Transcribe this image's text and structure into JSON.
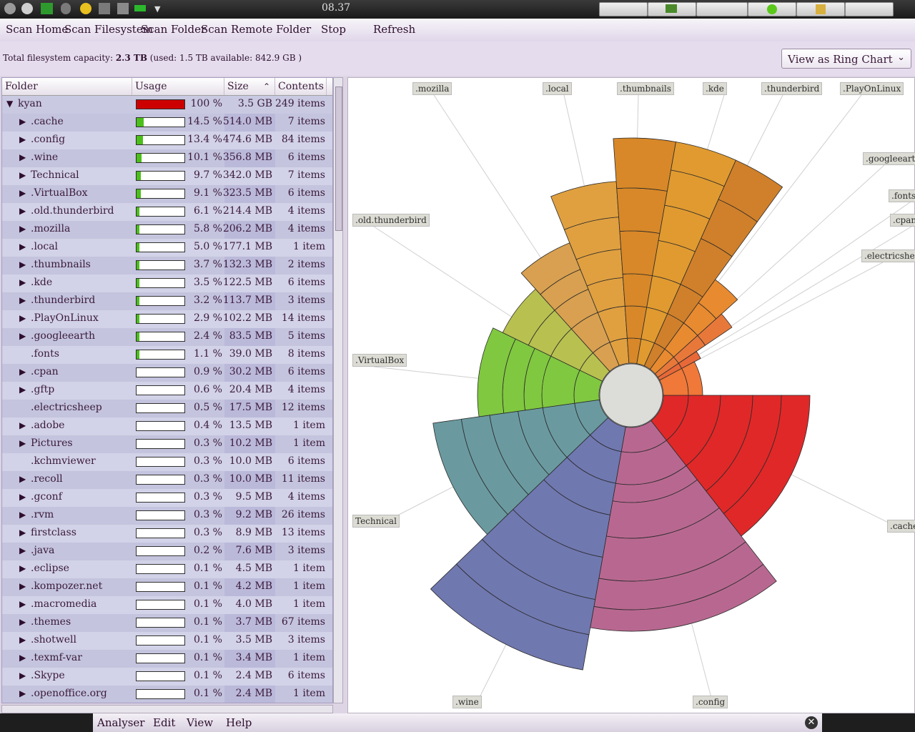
{
  "panel": {
    "clock": "08.37"
  },
  "toolbar": {
    "scan_home": "Scan Home",
    "scan_filesystem": "Scan Filesystem",
    "scan_folder": "Scan Folder",
    "scan_remote": "Scan Remote Folder",
    "stop": "Stop",
    "refresh": "Refresh"
  },
  "capacity": {
    "prefix": "Total filesystem capacity:",
    "total": "2.3 TB",
    "detail": "(used: 1.5 TB available: 842.9 GB )"
  },
  "view_select": {
    "value": "View as Ring Chart"
  },
  "list": {
    "headers": {
      "folder": "Folder",
      "usage": "Usage",
      "size": "Size",
      "contents": "Contents"
    },
    "rows": [
      {
        "name": "kyan",
        "pct": "100 %",
        "usage": 100,
        "size": "3.5 GB",
        "contents": "249 items",
        "expanded": true,
        "level": 0,
        "has_children": true
      },
      {
        "name": ".cache",
        "pct": "14.5 %",
        "usage": 14.5,
        "size": "514.0 MB",
        "contents": "7 items",
        "level": 1,
        "has_children": true
      },
      {
        "name": ".config",
        "pct": "13.4 %",
        "usage": 13.4,
        "size": "474.6 MB",
        "contents": "84 items",
        "level": 1,
        "has_children": true
      },
      {
        "name": ".wine",
        "pct": "10.1 %",
        "usage": 10.1,
        "size": "356.8 MB",
        "contents": "6 items",
        "level": 1,
        "has_children": true
      },
      {
        "name": "Technical",
        "pct": "9.7 %",
        "usage": 9.7,
        "size": "342.0 MB",
        "contents": "7 items",
        "level": 1,
        "has_children": true
      },
      {
        "name": ".VirtualBox",
        "pct": "9.1 %",
        "usage": 9.1,
        "size": "323.5 MB",
        "contents": "6 items",
        "level": 1,
        "has_children": true
      },
      {
        "name": ".old.thunderbird",
        "pct": "6.1 %",
        "usage": 6.1,
        "size": "214.4 MB",
        "contents": "4 items",
        "level": 1,
        "has_children": true
      },
      {
        "name": ".mozilla",
        "pct": "5.8 %",
        "usage": 5.8,
        "size": "206.2 MB",
        "contents": "4 items",
        "level": 1,
        "has_children": true
      },
      {
        "name": ".local",
        "pct": "5.0 %",
        "usage": 5.0,
        "size": "177.1 MB",
        "contents": "1 item",
        "level": 1,
        "has_children": true
      },
      {
        "name": ".thumbnails",
        "pct": "3.7 %",
        "usage": 3.7,
        "size": "132.3 MB",
        "contents": "2 items",
        "level": 1,
        "has_children": true
      },
      {
        "name": ".kde",
        "pct": "3.5 %",
        "usage": 3.5,
        "size": "122.5 MB",
        "contents": "6 items",
        "level": 1,
        "has_children": true
      },
      {
        "name": ".thunderbird",
        "pct": "3.2 %",
        "usage": 3.2,
        "size": "113.7 MB",
        "contents": "3 items",
        "level": 1,
        "has_children": true
      },
      {
        "name": ".PlayOnLinux",
        "pct": "2.9 %",
        "usage": 2.9,
        "size": "102.2 MB",
        "contents": "14 items",
        "level": 1,
        "has_children": true
      },
      {
        "name": ".googleearth",
        "pct": "2.4 %",
        "usage": 2.4,
        "size": "83.5 MB",
        "contents": "5 items",
        "level": 1,
        "has_children": true
      },
      {
        "name": ".fonts",
        "pct": "1.1 %",
        "usage": 1.1,
        "size": "39.0 MB",
        "contents": "8 items",
        "level": 1,
        "has_children": false
      },
      {
        "name": ".cpan",
        "pct": "0.9 %",
        "usage": 0.9,
        "size": "30.2 MB",
        "contents": "6 items",
        "level": 1,
        "has_children": true
      },
      {
        "name": ".gftp",
        "pct": "0.6 %",
        "usage": 0.6,
        "size": "20.4 MB",
        "contents": "4 items",
        "level": 1,
        "has_children": true
      },
      {
        "name": ".electricsheep",
        "pct": "0.5 %",
        "usage": 0.5,
        "size": "17.5 MB",
        "contents": "12 items",
        "level": 1,
        "has_children": false
      },
      {
        "name": ".adobe",
        "pct": "0.4 %",
        "usage": 0.4,
        "size": "13.5 MB",
        "contents": "1 item",
        "level": 1,
        "has_children": true
      },
      {
        "name": "Pictures",
        "pct": "0.3 %",
        "usage": 0.3,
        "size": "10.2 MB",
        "contents": "1 item",
        "level": 1,
        "has_children": true
      },
      {
        "name": ".kchmviewer",
        "pct": "0.3 %",
        "usage": 0.3,
        "size": "10.0 MB",
        "contents": "6 items",
        "level": 1,
        "has_children": false
      },
      {
        "name": ".recoll",
        "pct": "0.3 %",
        "usage": 0.3,
        "size": "10.0 MB",
        "contents": "11 items",
        "level": 1,
        "has_children": true
      },
      {
        "name": ".gconf",
        "pct": "0.3 %",
        "usage": 0.3,
        "size": "9.5 MB",
        "contents": "4 items",
        "level": 1,
        "has_children": true
      },
      {
        "name": ".rvm",
        "pct": "0.3 %",
        "usage": 0.3,
        "size": "9.2 MB",
        "contents": "26 items",
        "level": 1,
        "has_children": true
      },
      {
        "name": "firstclass",
        "pct": "0.3 %",
        "usage": 0.3,
        "size": "8.9 MB",
        "contents": "13 items",
        "level": 1,
        "has_children": true
      },
      {
        "name": ".java",
        "pct": "0.2 %",
        "usage": 0.2,
        "size": "7.6 MB",
        "contents": "3 items",
        "level": 1,
        "has_children": true
      },
      {
        "name": ".eclipse",
        "pct": "0.1 %",
        "usage": 0.1,
        "size": "4.5 MB",
        "contents": "1 item",
        "level": 1,
        "has_children": true
      },
      {
        "name": ".kompozer.net",
        "pct": "0.1 %",
        "usage": 0.1,
        "size": "4.2 MB",
        "contents": "1 item",
        "level": 1,
        "has_children": true
      },
      {
        "name": ".macromedia",
        "pct": "0.1 %",
        "usage": 0.1,
        "size": "4.0 MB",
        "contents": "1 item",
        "level": 1,
        "has_children": true
      },
      {
        "name": ".themes",
        "pct": "0.1 %",
        "usage": 0.1,
        "size": "3.7 MB",
        "contents": "67 items",
        "level": 1,
        "has_children": true
      },
      {
        "name": ".shotwell",
        "pct": "0.1 %",
        "usage": 0.1,
        "size": "3.5 MB",
        "contents": "3 items",
        "level": 1,
        "has_children": true
      },
      {
        "name": ".texmf-var",
        "pct": "0.1 %",
        "usage": 0.1,
        "size": "3.4 MB",
        "contents": "1 item",
        "level": 1,
        "has_children": true
      },
      {
        "name": ".Skype",
        "pct": "0.1 %",
        "usage": 0.1,
        "size": "2.4 MB",
        "contents": "6 items",
        "level": 1,
        "has_children": true
      },
      {
        "name": ".openoffice.org",
        "pct": "0.1 %",
        "usage": 0.1,
        "size": "2.4 MB",
        "contents": "1 item",
        "level": 1,
        "has_children": true
      }
    ]
  },
  "ring_chart": {
    "labels": [
      ".mozilla",
      ".local",
      ".thumbnails",
      ".kde",
      ".thunderbird",
      ".PlayOnLinux",
      ".googleearth",
      ".fonts",
      ".cpan",
      ".electricsheep",
      ".old.thunderbird",
      ".VirtualBox",
      "Technical",
      ".cache",
      ".wine",
      ".config"
    ]
  },
  "menu": {
    "analyser": "Analyser",
    "edit": "Edit",
    "view": "View",
    "help": "Help"
  },
  "colors": {
    "usage_full": "#cc0000",
    "usage_bar": "#4bbf1a",
    "list_bg": "#c4c4de"
  }
}
